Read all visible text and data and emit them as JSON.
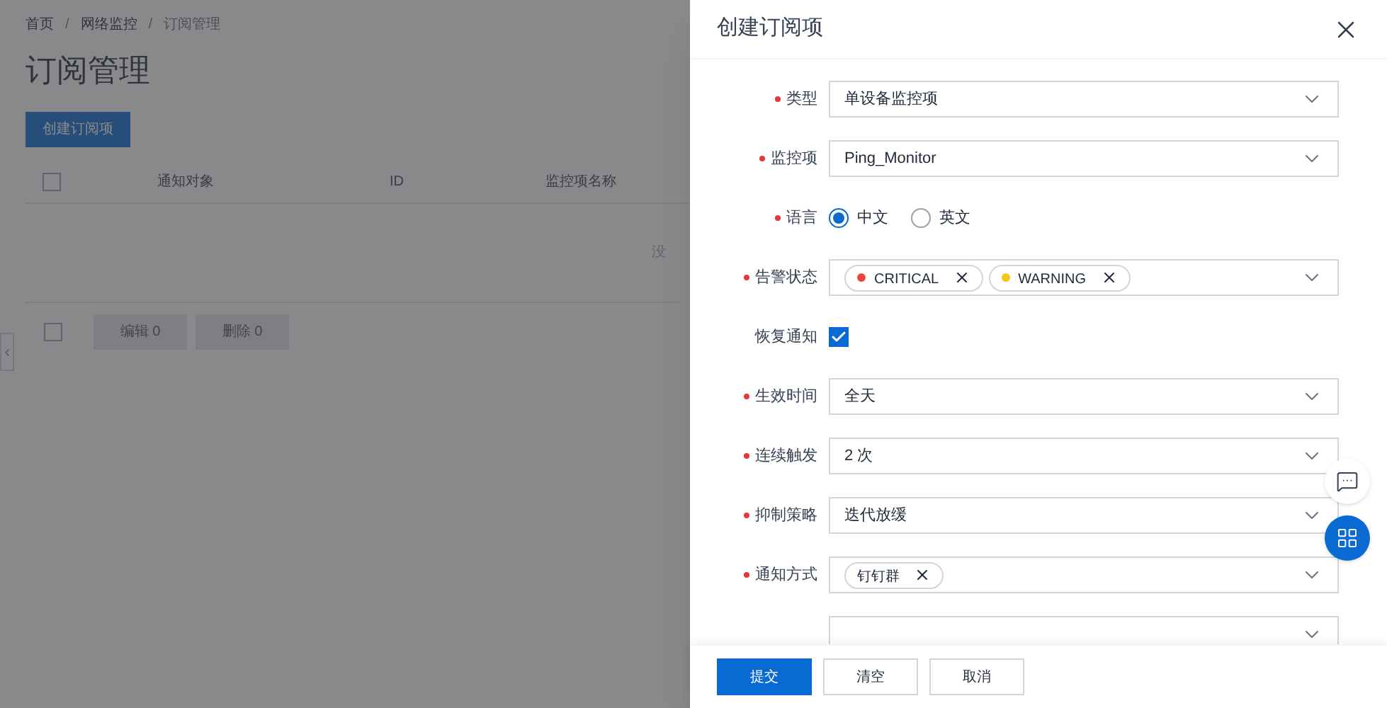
{
  "breadcrumb": [
    {
      "label": "首页"
    },
    {
      "separator": "/"
    },
    {
      "label": "网络监控"
    },
    {
      "separator": "/"
    },
    {
      "label": "订阅管理"
    }
  ],
  "page_title": "订阅管理",
  "create_button": "创建订阅项",
  "table": {
    "select_all_checked": false,
    "columns": [
      "通知对象",
      "ID",
      "监控项名称"
    ],
    "empty_text": "没"
  },
  "bulk_select_checked": false,
  "bulk_actions": [
    {
      "label": "编辑 0",
      "disabled": true
    },
    {
      "label": "删除 0",
      "disabled": true
    }
  ],
  "drawer": {
    "title": "创建订阅项",
    "fields": [
      {
        "kind": "select",
        "label": "类型",
        "required": true,
        "value": "单设备监控项"
      },
      {
        "kind": "select",
        "label": "监控项",
        "required": true,
        "value": "Ping_Monitor"
      },
      {
        "kind": "radio",
        "label": "语言",
        "required": true,
        "options": [
          {
            "label": "中文",
            "selected": true
          },
          {
            "label": "英文",
            "selected": false
          }
        ]
      },
      {
        "kind": "tags",
        "label": "告警状态",
        "required": true,
        "tags": [
          {
            "label": "CRITICAL",
            "color": "#f04438"
          },
          {
            "label": "WARNING",
            "color": "#f5c518"
          }
        ]
      },
      {
        "kind": "checkbox",
        "label": "恢复通知",
        "required": false,
        "checked": true
      },
      {
        "kind": "select",
        "label": "生效时间",
        "required": true,
        "value": "全天"
      },
      {
        "kind": "select",
        "label": "连续触发",
        "required": true,
        "value": "2 次"
      },
      {
        "kind": "select",
        "label": "抑制策略",
        "required": true,
        "value": "迭代放缓"
      },
      {
        "kind": "tags",
        "label": "通知方式",
        "required": true,
        "tags": [
          {
            "label": "钉钉群"
          }
        ]
      },
      {
        "kind": "select",
        "required": false
      }
    ],
    "footer_buttons": [
      {
        "label": "提交",
        "kind": "primary"
      },
      {
        "label": "清空",
        "kind": "default"
      },
      {
        "label": "取消",
        "kind": "default"
      }
    ]
  }
}
